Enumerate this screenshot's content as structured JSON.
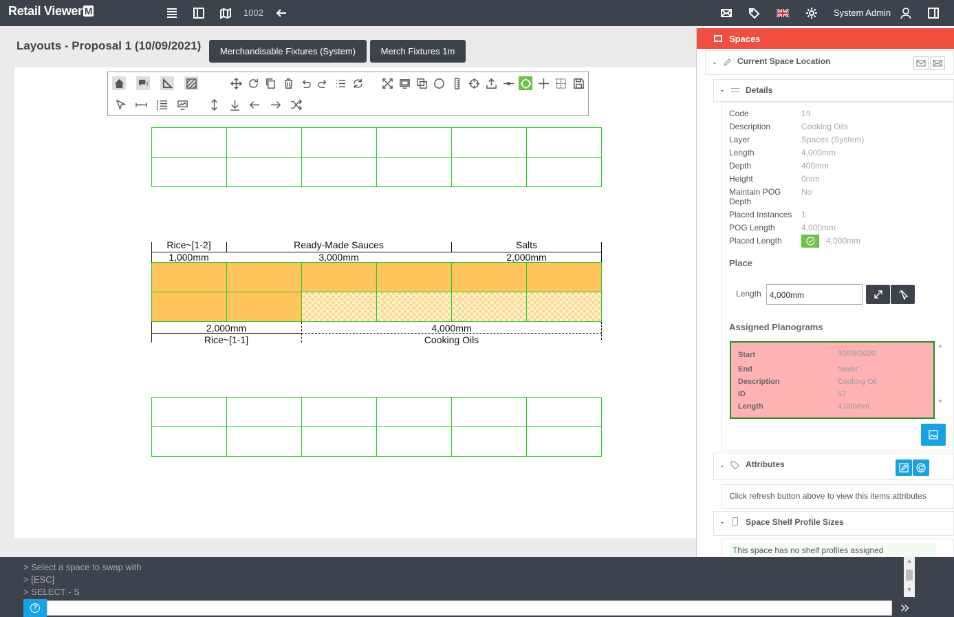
{
  "app": {
    "name": "Retail Viewer",
    "badge": "M"
  },
  "topbar": {
    "record_id": "1002",
    "user": "System Admin"
  },
  "page": {
    "title": "Layouts - Proposal 1 (10/09/2021)"
  },
  "header_buttons": [
    {
      "label": "Merchandisable Fixtures (System)"
    },
    {
      "label": "Merch Fixtures 1m"
    }
  ],
  "drawing": {
    "top_labels": [
      "Rice~[1-2]",
      "Ready-Made Sauces",
      "Salts"
    ],
    "top_lengths": [
      "1,000mm",
      "3,000mm",
      "2,000mm"
    ],
    "bottom_lengths": [
      "2,000mm",
      "4,000mm"
    ],
    "bottom_labels": [
      "Rice~[1-1]",
      "Cooking Oils"
    ]
  },
  "panel": {
    "title": "Spaces",
    "current_location": "Current Space Location",
    "details_title": "Details",
    "details": [
      {
        "label": "Code",
        "value": "19"
      },
      {
        "label": "Description",
        "value": "Cooking Oils"
      },
      {
        "label": "Layer",
        "value": "Spaces (System)"
      },
      {
        "label": "Length",
        "value": "4,000mm"
      },
      {
        "label": "Depth",
        "value": "400mm"
      },
      {
        "label": "Height",
        "value": "0mm"
      },
      {
        "label": "Maintain POG Depth",
        "value": "No"
      },
      {
        "label": "Placed Instances",
        "value": "1"
      },
      {
        "label": "POG Length",
        "value": "4,000mm"
      },
      {
        "label": "Placed Length",
        "value": "4,000mm"
      }
    ],
    "place_title": "Place",
    "place_length_label": "Length",
    "place_length_value": "4,000mm",
    "assigned_title": "Assigned Planograms",
    "planogram": [
      {
        "key": "Start",
        "value": "30/09/2020"
      },
      {
        "key": "End",
        "value": "Never"
      },
      {
        "key": "Description",
        "value": "Cooking Oil"
      },
      {
        "key": "ID",
        "value": "67"
      },
      {
        "key": "Length",
        "value": "4,000mm"
      }
    ],
    "attributes_title": "Attributes",
    "attributes_hint": "Click refresh button above to view this items attributes",
    "shelf_title": "Space Shelf Profile Sizes",
    "shelf_hint": "This space has no shelf profiles assigned"
  },
  "console": {
    "lines": [
      "> Select a space to swap with",
      "> [ESC]",
      "> SELECT - S"
    ],
    "help": "?"
  },
  "colors": {
    "topbar": "#3c434c",
    "panel_header": "#f24e40",
    "bay": "#ffc55c",
    "grid": "#22cc22",
    "planogram_bg": "#ffb3b3",
    "accent_blue": "#17a2e5",
    "accent_green": "#6bc24a"
  }
}
